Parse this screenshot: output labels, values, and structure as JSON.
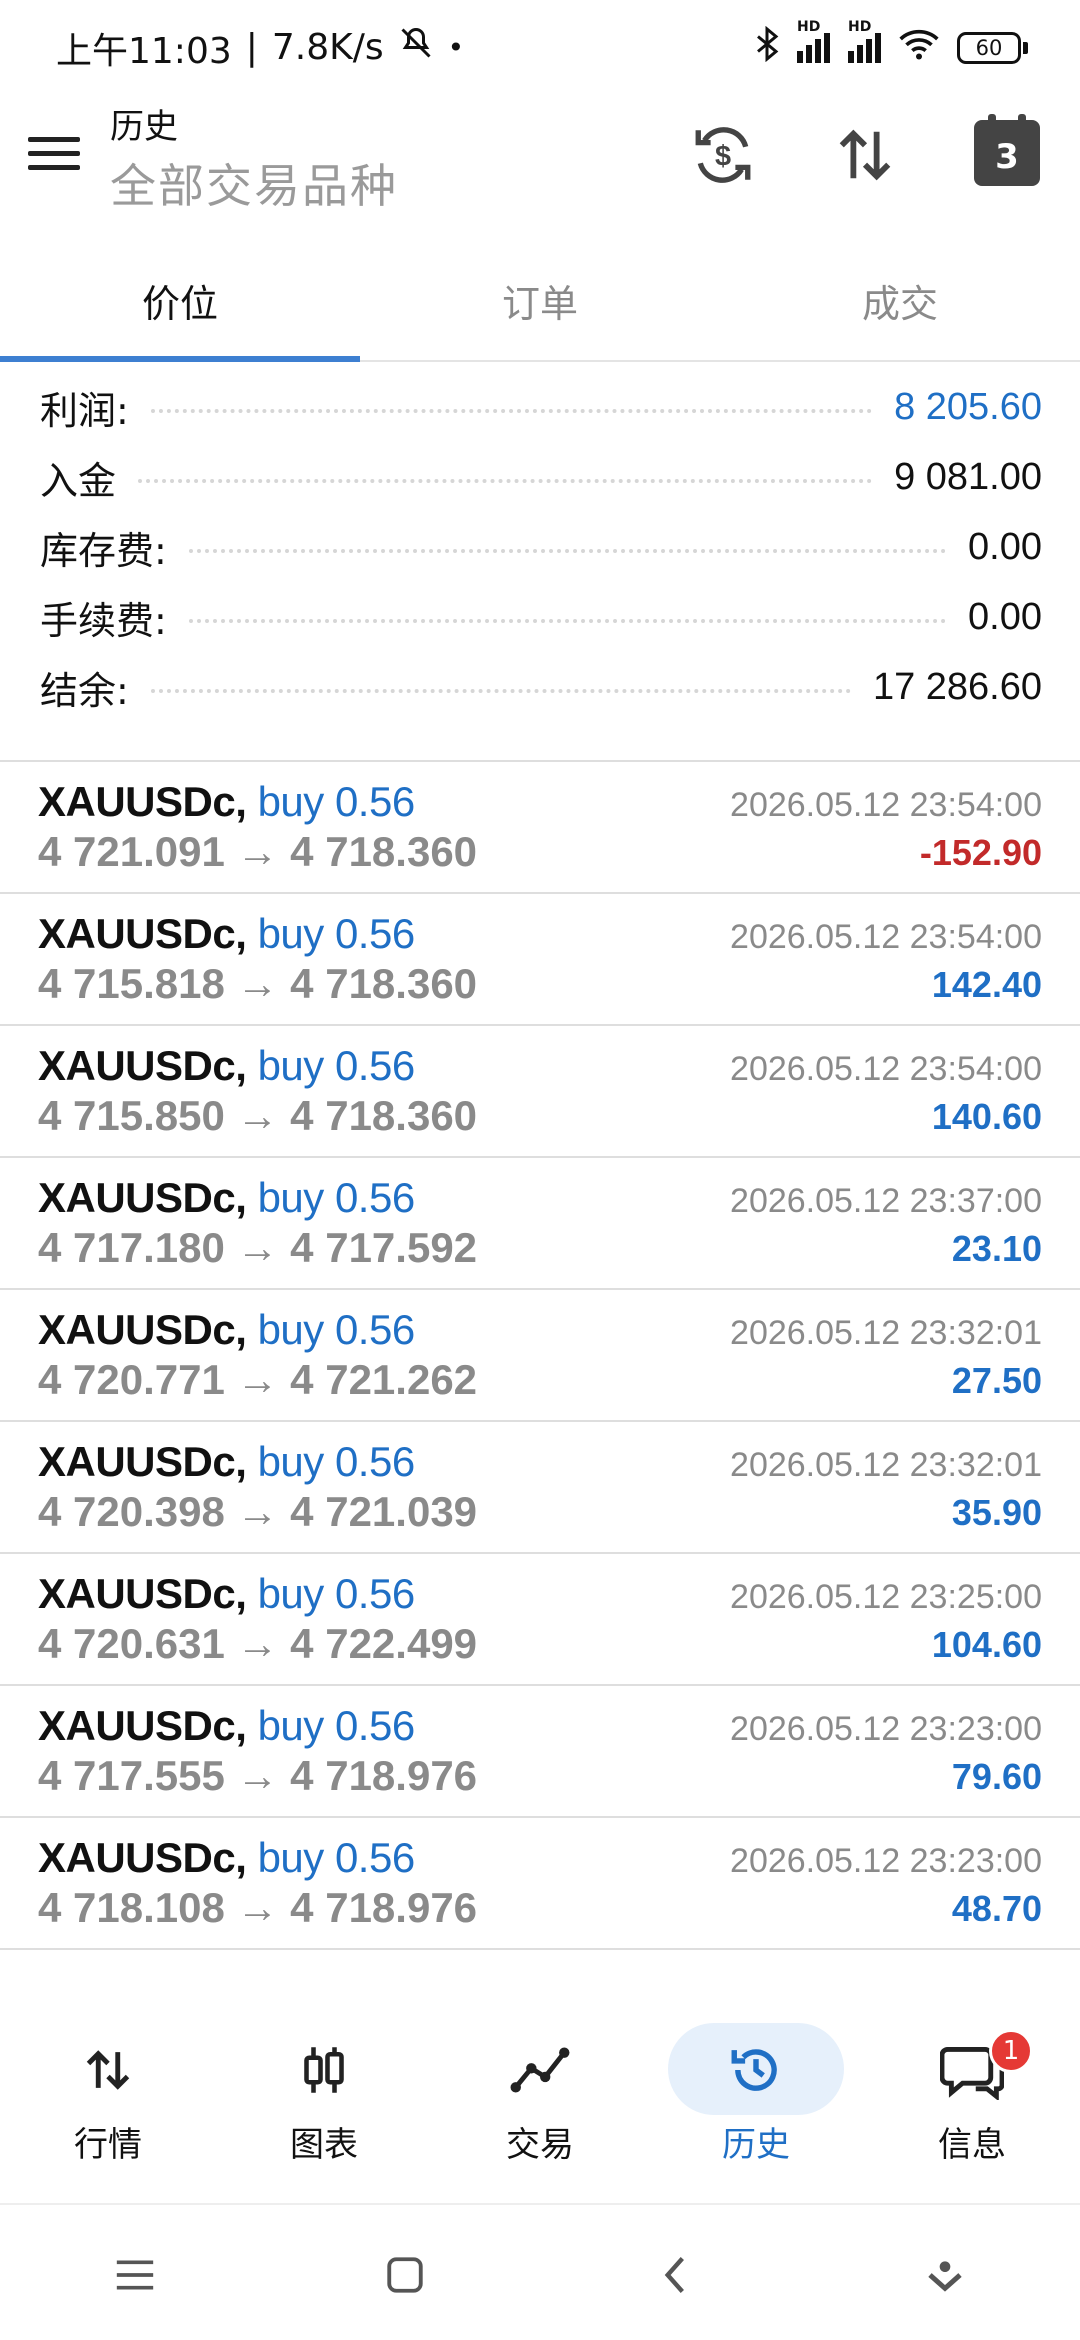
{
  "status_bar": {
    "time": "上午11:03",
    "net_speed": "7.8K/s",
    "battery": "60",
    "hd1": "HD",
    "hd2": "HD"
  },
  "header": {
    "title": "历史",
    "subtitle": "全部交易品种",
    "calendar_day": "3"
  },
  "tabs": [
    {
      "label": "价位",
      "active": true
    },
    {
      "label": "订单",
      "active": false
    },
    {
      "label": "成交",
      "active": false
    }
  ],
  "summary": [
    {
      "label": "利润:",
      "value": "8 205.60",
      "highlight": true
    },
    {
      "label": "入金",
      "value": "9 081.00",
      "highlight": false
    },
    {
      "label": "库存费:",
      "value": "0.00",
      "highlight": false
    },
    {
      "label": "手续费:",
      "value": "0.00",
      "highlight": false
    },
    {
      "label": "结余:",
      "value": "17 286.60",
      "highlight": false
    }
  ],
  "deals": [
    {
      "symbol": "XAUUSDc,",
      "side": "buy 0.56",
      "prices": "4 721.091 → 4 718.360",
      "time": "2026.05.12 23:54:00",
      "profit": "-152.90"
    },
    {
      "symbol": "XAUUSDc,",
      "side": "buy 0.56",
      "prices": "4 715.818 → 4 718.360",
      "time": "2026.05.12 23:54:00",
      "profit": "142.40"
    },
    {
      "symbol": "XAUUSDc,",
      "side": "buy 0.56",
      "prices": "4 715.850 → 4 718.360",
      "time": "2026.05.12 23:54:00",
      "profit": "140.60"
    },
    {
      "symbol": "XAUUSDc,",
      "side": "buy 0.56",
      "prices": "4 717.180 → 4 717.592",
      "time": "2026.05.12 23:37:00",
      "profit": "23.10"
    },
    {
      "symbol": "XAUUSDc,",
      "side": "buy 0.56",
      "prices": "4 720.771 → 4 721.262",
      "time": "2026.05.12 23:32:01",
      "profit": "27.50"
    },
    {
      "symbol": "XAUUSDc,",
      "side": "buy 0.56",
      "prices": "4 720.398 → 4 721.039",
      "time": "2026.05.12 23:32:01",
      "profit": "35.90"
    },
    {
      "symbol": "XAUUSDc,",
      "side": "buy 0.56",
      "prices": "4 720.631 → 4 722.499",
      "time": "2026.05.12 23:25:00",
      "profit": "104.60"
    },
    {
      "symbol": "XAUUSDc,",
      "side": "buy 0.56",
      "prices": "4 717.555 → 4 718.976",
      "time": "2026.05.12 23:23:00",
      "profit": "79.60"
    },
    {
      "symbol": "XAUUSDc,",
      "side": "buy 0.56",
      "prices": "4 718.108 → 4 718.976",
      "time": "2026.05.12 23:23:00",
      "profit": "48.70"
    }
  ],
  "bottom_nav": [
    {
      "label": "行情",
      "icon": "updown-arrows-icon",
      "active": false
    },
    {
      "label": "图表",
      "icon": "candlestick-icon",
      "active": false
    },
    {
      "label": "交易",
      "icon": "trade-line-icon",
      "active": false
    },
    {
      "label": "历史",
      "icon": "history-clock-icon",
      "active": true
    },
    {
      "label": "信息",
      "icon": "chat-bubble-icon",
      "active": false,
      "badge": "1"
    }
  ],
  "colors": {
    "accent": "#1f6fc5",
    "negative": "#c22a2a",
    "tab_indicator": "#3d7fd1"
  }
}
